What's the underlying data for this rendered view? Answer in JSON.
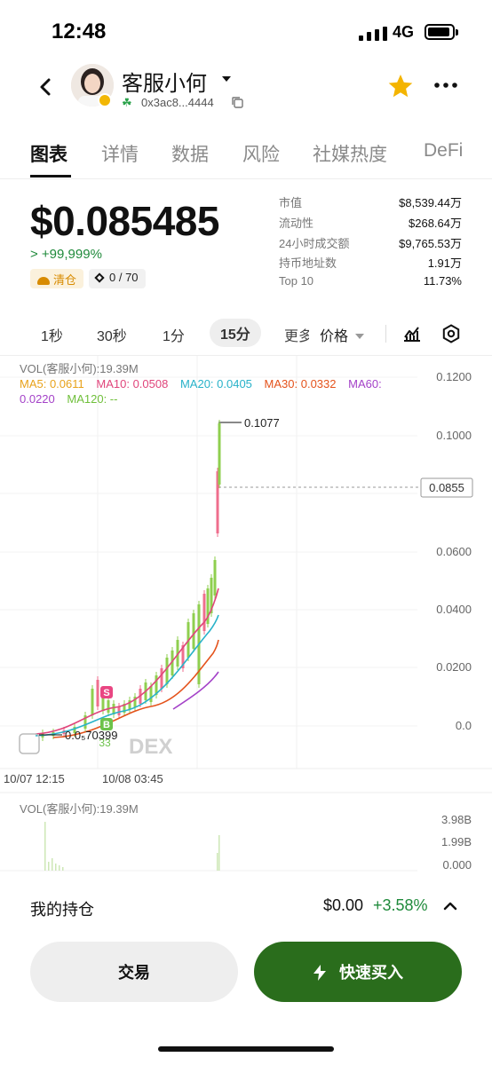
{
  "status_bar": {
    "time": "12:48",
    "network": "4G"
  },
  "header": {
    "token_name": "客服小何",
    "address": "0x3ac8...4444"
  },
  "tabs": [
    "图表",
    "详情",
    "数据",
    "风险",
    "社媒热度",
    "DeFi"
  ],
  "price": {
    "value": "$0.085485",
    "change": "> +99,999%",
    "badge_clear": "清仓",
    "badge_count": "0 / 70"
  },
  "stats": [
    {
      "label": "市值",
      "value": "$8,539.44万"
    },
    {
      "label": "流动性",
      "value": "$268.64万"
    },
    {
      "label": "24小时成交额",
      "value": "$9,765.53万"
    },
    {
      "label": "持币地址数",
      "value": "1.91万"
    },
    {
      "label": "Top 10",
      "value": "11.73%"
    }
  ],
  "intervals": [
    "1秒",
    "30秒",
    "1分",
    "15分",
    "更多"
  ],
  "active_interval": "15分",
  "price_select": "价格",
  "chart": {
    "vol_title": "VOL(客服小何):19.39M",
    "ma": [
      {
        "label": "MA5: 0.0611",
        "color": "#e8a21a"
      },
      {
        "label": "MA10: 0.0508",
        "color": "#e0457b"
      },
      {
        "label": "MA20: 0.0405",
        "color": "#28b2c9"
      },
      {
        "label": "MA30: 0.0332",
        "color": "#e4521b"
      },
      {
        "label": "MA60: 0.0220",
        "color": "#a442c8"
      },
      {
        "label": "MA120: --",
        "color": "#6fbf3a"
      }
    ],
    "y_labels": [
      "0.1200",
      "0.1000",
      "0.0855",
      "0.0600",
      "0.0400",
      "0.0200",
      "0.0"
    ],
    "current_price": "0.0855",
    "high_label": "0.1077",
    "low_label": "0.0₅70399",
    "x_labels": [
      "10/07 12:15",
      "10/08 03:45"
    ],
    "watermark": "DEX",
    "marker_s": "S",
    "marker_b": "B",
    "marker_b_count": "33",
    "vol_panel_title": "VOL(客服小何):19.39M",
    "vol_labels": [
      "3.98B",
      "1.99B",
      "0.000"
    ]
  },
  "holding": {
    "label": "我的持仓",
    "value": "$0.00",
    "pct": "+3.58%"
  },
  "buttons": {
    "trade": "交易",
    "quick_buy": "快速买入"
  },
  "colors": {
    "up": "#1f8a3b",
    "buy_button": "#2a6d1c",
    "star": "#f4b400"
  }
}
